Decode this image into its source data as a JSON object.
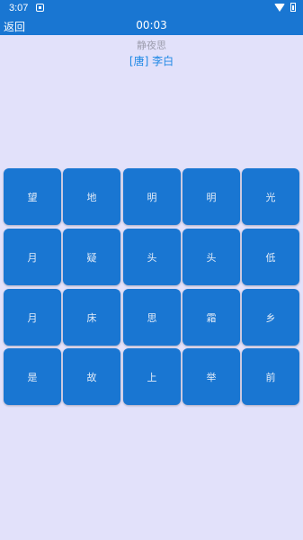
{
  "status_bar": {
    "time": "3:07",
    "battery_level": "1"
  },
  "header": {
    "back_label": "返回",
    "timer": "00:03"
  },
  "poem": {
    "title": "静夜思",
    "author": "[唐] 李白"
  },
  "grid": {
    "rows": [
      [
        "望",
        "地",
        "明",
        "明",
        "光"
      ],
      [
        "月",
        "疑",
        "头",
        "头",
        "低"
      ],
      [
        "月",
        "床",
        "思",
        "霜",
        "乡"
      ],
      [
        "是",
        "故",
        "上",
        "举",
        "前"
      ]
    ]
  },
  "colors": {
    "primary": "#1976D2",
    "background": "#E2E1FA",
    "author_text": "#1E88E5",
    "title_text": "#9E9EAF"
  }
}
